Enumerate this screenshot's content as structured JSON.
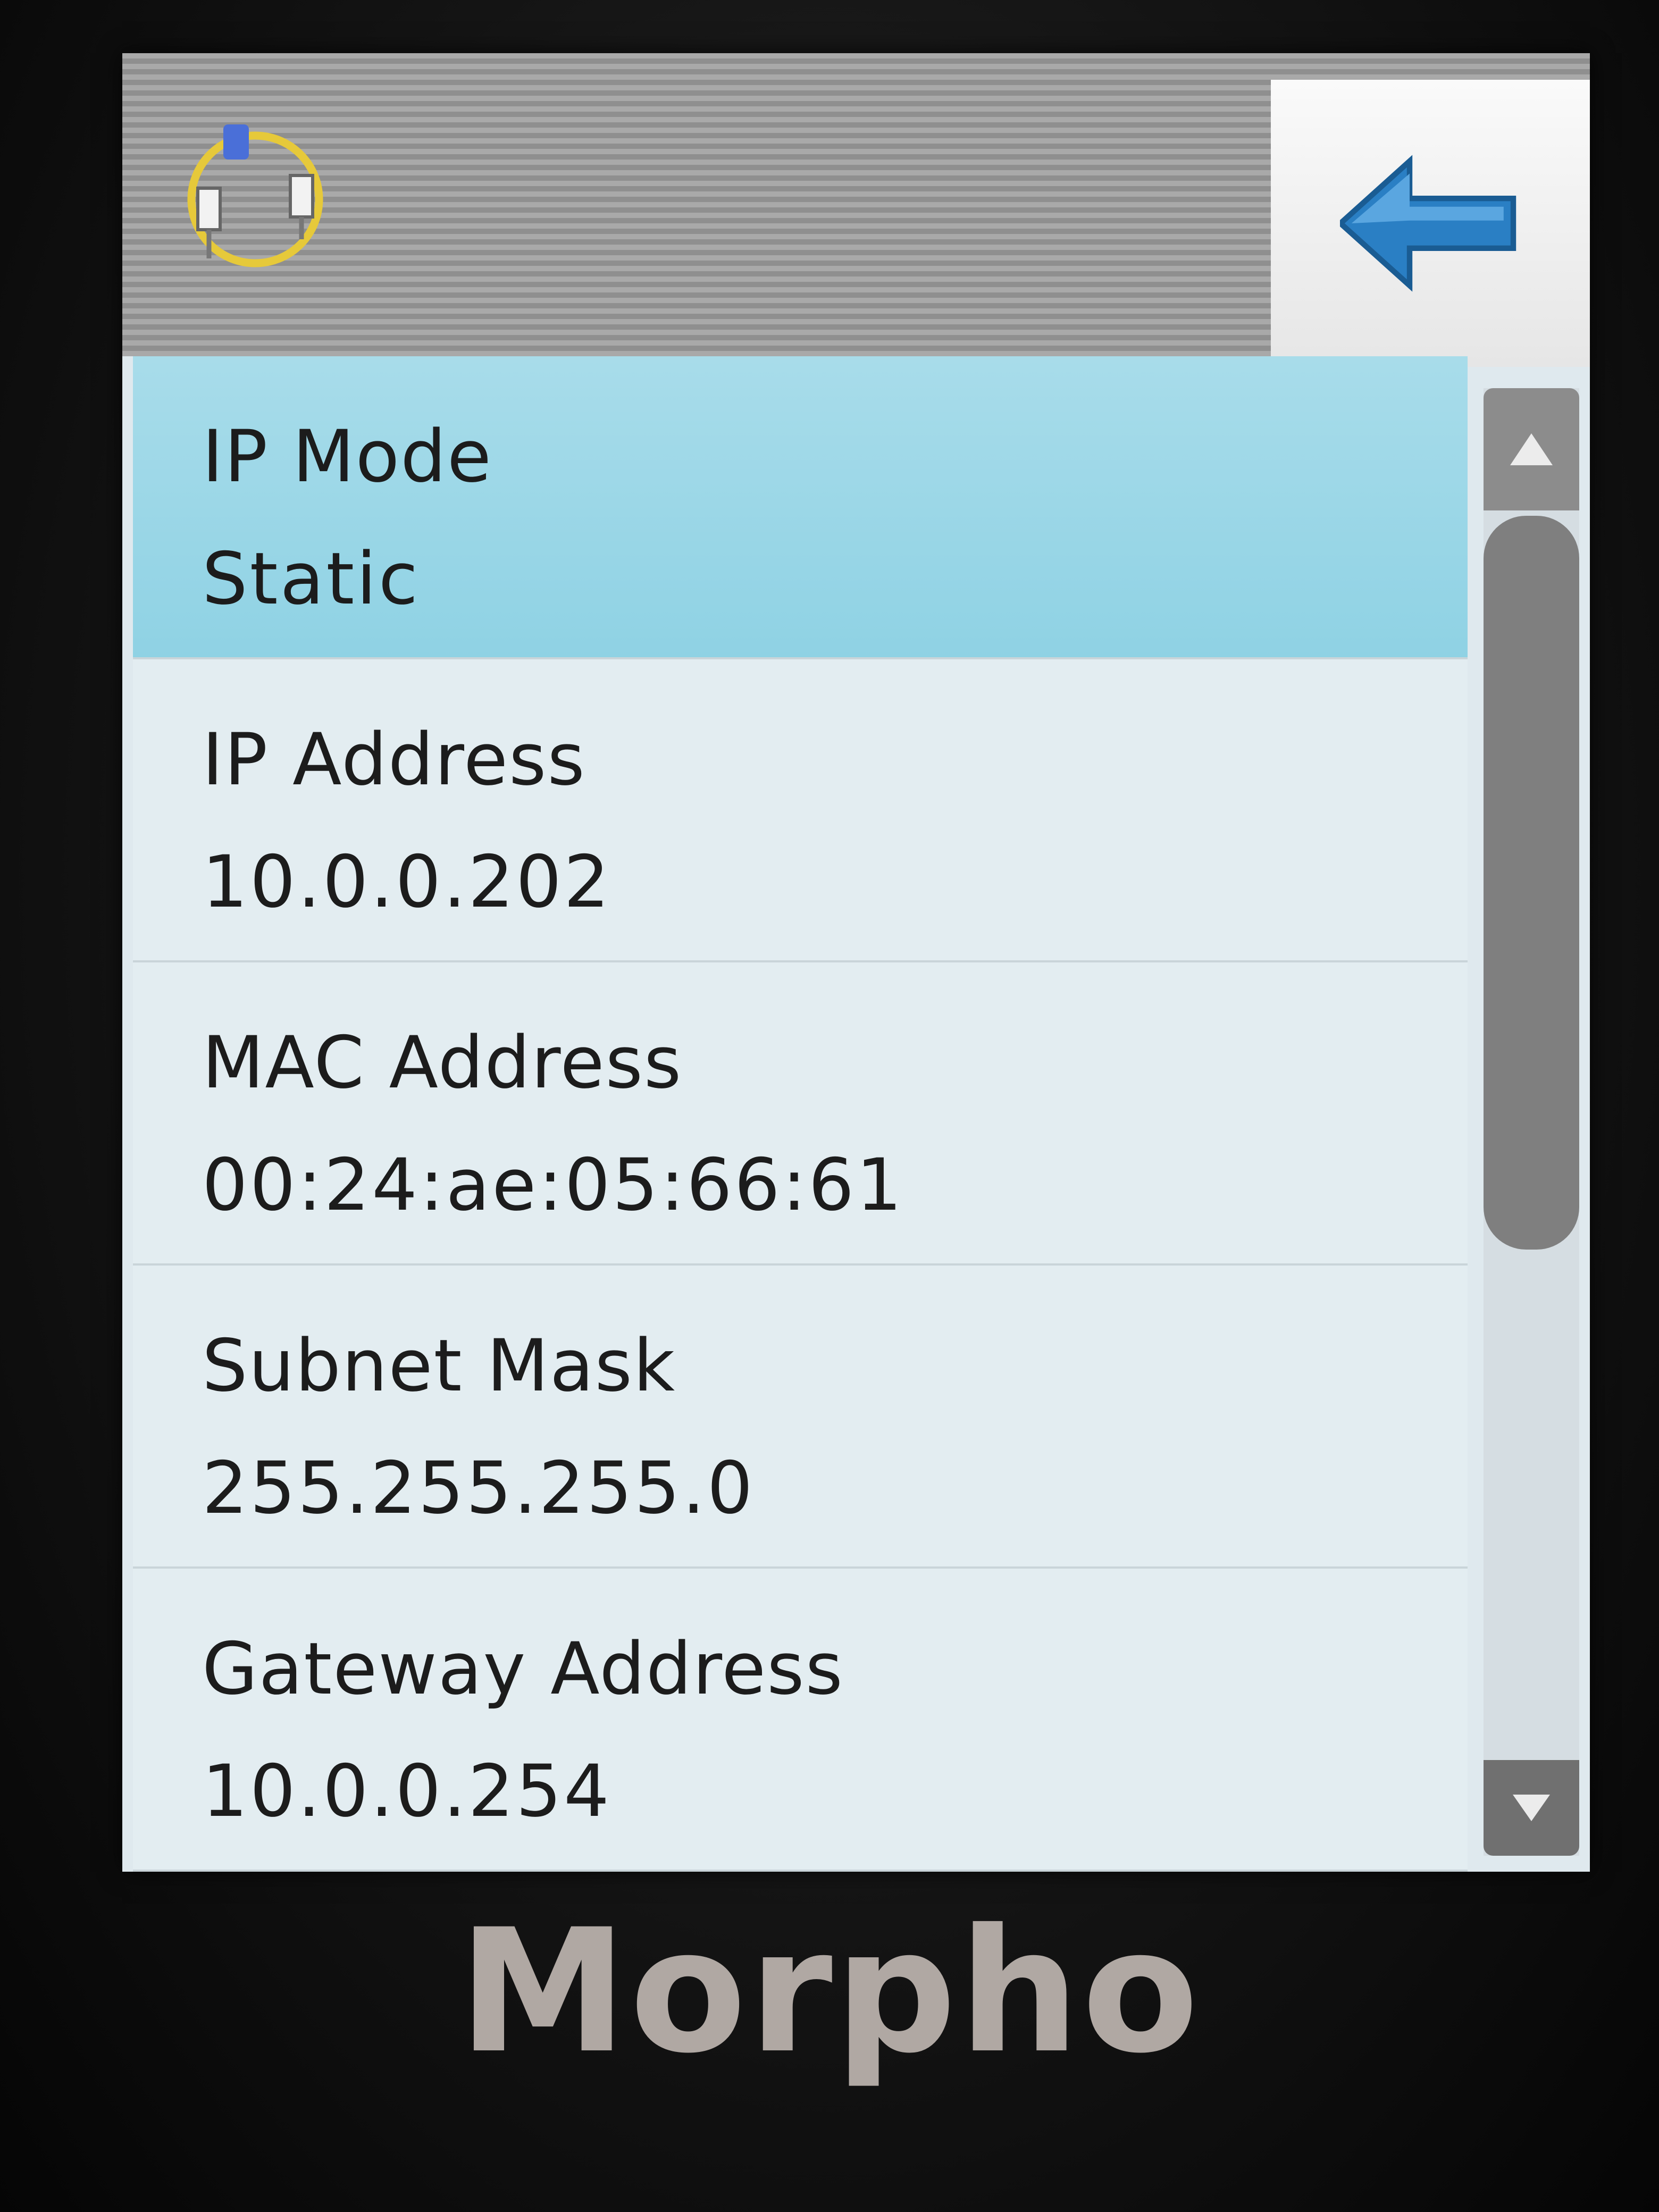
{
  "header": {
    "icon": "network-settings-icon",
    "back_icon": "back-arrow-icon"
  },
  "settings": [
    {
      "label": "IP Mode",
      "value": "Static",
      "selected": true
    },
    {
      "label": "IP Address",
      "value": "10.0.0.202",
      "selected": false
    },
    {
      "label": "MAC Address",
      "value": "00:24:ae:05:66:61",
      "selected": false
    },
    {
      "label": "Subnet Mask",
      "value": "255.255.255.0",
      "selected": false
    },
    {
      "label": "Gateway Address",
      "value": "10.0.0.254",
      "selected": false
    }
  ],
  "scrollbar": {
    "up_icon": "triangle-up-icon",
    "down_icon": "triangle-down-icon"
  },
  "brand": "Morpho",
  "colors": {
    "selected_row": "#9fd8e8",
    "row": "#e3edf1",
    "back_arrow": "#2a7fc4"
  }
}
